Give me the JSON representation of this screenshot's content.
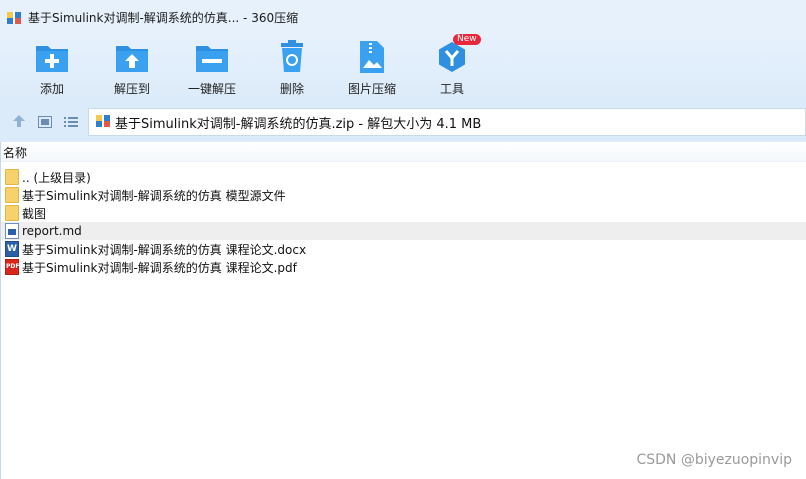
{
  "window": {
    "title": "基于Simulink对调制-解调系统的仿真... - 360压缩"
  },
  "toolbar": {
    "items": [
      {
        "label": "添加",
        "icon": "add-icon"
      },
      {
        "label": "解压到",
        "icon": "extract-to-icon"
      },
      {
        "label": "一键解压",
        "icon": "one-click-extract-icon"
      },
      {
        "label": "删除",
        "icon": "delete-icon"
      },
      {
        "label": "图片压缩",
        "icon": "image-compress-icon"
      },
      {
        "label": "工具",
        "icon": "tools-icon",
        "badge": "New"
      }
    ]
  },
  "navbar": {
    "path_text": "基于Simulink对调制-解调系统的仿真.zip - 解包大小为 4.1 MB"
  },
  "filelist": {
    "column_name": "名称",
    "rows": [
      {
        "name": ".. (上级目录)",
        "type": "folder"
      },
      {
        "name": "基于Simulink对调制-解调系统的仿真 模型源文件",
        "type": "folder"
      },
      {
        "name": "截图",
        "type": "folder"
      },
      {
        "name": "report.md",
        "type": "md",
        "selected": true
      },
      {
        "name": "基于Simulink对调制-解调系统的仿真 课程论文.docx",
        "type": "docx",
        "icon_text": "W"
      },
      {
        "name": "基于Simulink对调制-解调系统的仿真 课程论文.pdf",
        "type": "pdf",
        "icon_text": "PDF"
      }
    ]
  },
  "watermark": "CSDN @biyezuopinvip",
  "colors": {
    "accent_blue": "#2f8fe0",
    "titlebar_bg": "#e6f1fc",
    "new_badge": "#e8283a",
    "folder": "#f7d16b"
  }
}
